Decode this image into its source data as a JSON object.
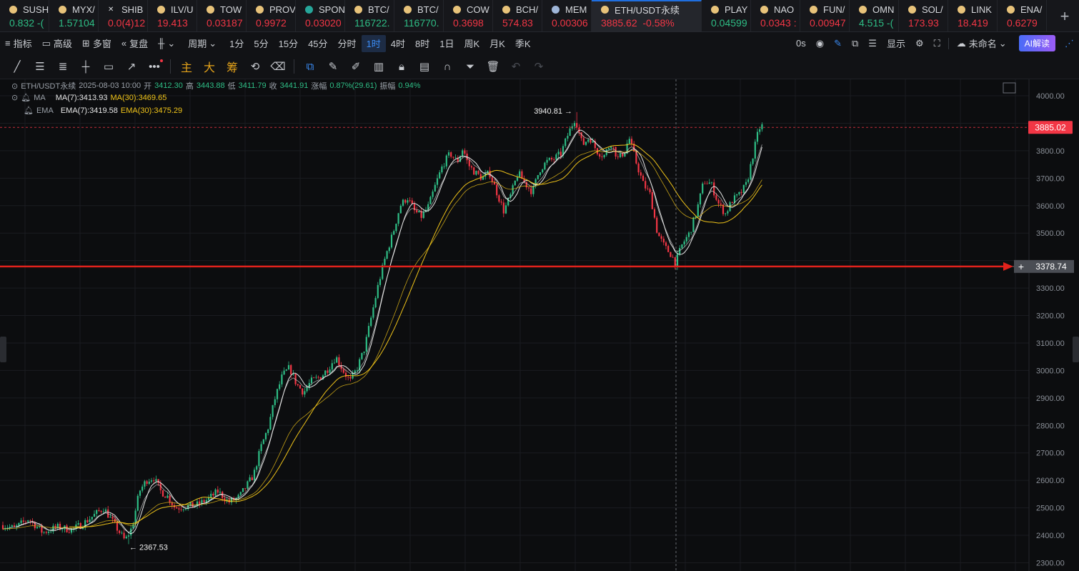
{
  "ticker_tabs": [
    {
      "symbol": "SUSH",
      "value": "0.832 -(",
      "dir": "up",
      "icon": "coin-icon",
      "icon_color": "#e8c37a"
    },
    {
      "symbol": "MYX/",
      "value": "1.57104",
      "dir": "up",
      "icon": "coin-icon",
      "icon_color": "#e8c37a"
    },
    {
      "symbol": "SHIB",
      "value": "0.0(4)12",
      "dir": "dn",
      "icon": "close-icon",
      "icon_color": "#d6d8dc"
    },
    {
      "symbol": "ILV/U",
      "value": "19.413",
      "dir": "dn",
      "icon": "coin-icon",
      "icon_color": "#e8c37a"
    },
    {
      "symbol": "TOW",
      "value": "0.03187",
      "dir": "dn",
      "icon": "coin-icon",
      "icon_color": "#e8c37a"
    },
    {
      "symbol": "PROV",
      "value": "0.9972",
      "dir": "dn",
      "icon": "coin-icon",
      "icon_color": "#e8c37a"
    },
    {
      "symbol": "SPON",
      "value": "0.03020",
      "dir": "dn",
      "icon": "coin-icon",
      "icon_color": "#26a69a"
    },
    {
      "symbol": "BTC/",
      "value": "116722.",
      "dir": "up",
      "icon": "coin-icon",
      "icon_color": "#e8c37a"
    },
    {
      "symbol": "BTC/",
      "value": "116770.",
      "dir": "up",
      "icon": "coin-icon",
      "icon_color": "#e8c37a"
    },
    {
      "symbol": "COW",
      "value": "0.3698",
      "dir": "dn",
      "icon": "coin-icon",
      "icon_color": "#e8c37a"
    },
    {
      "symbol": "BCH/",
      "value": "574.83",
      "dir": "dn",
      "icon": "coin-icon",
      "icon_color": "#e8c37a"
    },
    {
      "symbol": "MEM",
      "value": "0.00306",
      "dir": "dn",
      "icon": "coin-icon",
      "icon_color": "#9fb6d8"
    }
  ],
  "active_tab": {
    "symbol": "ETH/USDT永续",
    "price": "3885.62",
    "change": "-0.58%",
    "icon": "coin-icon",
    "icon_color": "#e8c37a"
  },
  "ticker_tabs_right": [
    {
      "symbol": "PLAY",
      "value": "0.04599",
      "dir": "up",
      "icon": "coin-icon",
      "icon_color": "#e8c37a"
    },
    {
      "symbol": "NAO",
      "value": "0.0343 :",
      "dir": "dn",
      "icon": "coin-icon",
      "icon_color": "#e8c37a"
    },
    {
      "symbol": "FUN/",
      "value": "0.00947",
      "dir": "dn",
      "icon": "coin-icon",
      "icon_color": "#e8c37a"
    },
    {
      "symbol": "OMN",
      "value": "4.515 -(",
      "dir": "up",
      "icon": "coin-icon",
      "icon_color": "#e8c37a"
    },
    {
      "symbol": "SOL/",
      "value": "173.93",
      "dir": "dn",
      "icon": "coin-icon",
      "icon_color": "#e8c37a"
    },
    {
      "symbol": "LINK",
      "value": "18.419",
      "dir": "dn",
      "icon": "coin-icon",
      "icon_color": "#e8c37a"
    },
    {
      "symbol": "ENA/",
      "value": "0.6279",
      "dir": "dn",
      "icon": "coin-icon",
      "icon_color": "#e8c37a"
    }
  ],
  "toolbar": {
    "indicators": "指标",
    "advanced": "高级",
    "multi_window": "多窗",
    "replay": "复盘",
    "period": "周期",
    "intervals": [
      "1分",
      "5分",
      "15分",
      "45分",
      "分时",
      "1时",
      "4时",
      "8时",
      "1日",
      "周K",
      "月K",
      "季K"
    ],
    "selected_interval": "1时",
    "countdown": "0s",
    "display": "显示",
    "layout_name": "未命名",
    "ai_button": "AI解读"
  },
  "draw_tools_cn": [
    "主",
    "大",
    "筹"
  ],
  "legend": {
    "symbol": "ETH/USDT永续",
    "datetime": "2025-08-03 10:00",
    "open_label": "开",
    "open": "3412.30",
    "high_label": "高",
    "high": "3443.88",
    "low_label": "低",
    "low": "3411.79",
    "close_label": "收",
    "close": "3441.91",
    "change_label": "涨幅",
    "change": "0.87%(29.61)",
    "amp_label": "振幅",
    "amp": "0.94%",
    "ma_name": "MA",
    "ma7": "MA(7):3413.93",
    "ma30": "MA(30):3469.65",
    "ema_name": "EMA",
    "ema7": "EMA(7):3419.58",
    "ema30": "EMA(30):3475.29"
  },
  "colors": {
    "up": "#2ebd85",
    "down": "#f23645",
    "ma7": "#e6e6e6",
    "ma30": "#f0c419",
    "annotation": "#e1221c",
    "accent": "#3b8cf5"
  },
  "chart_data": {
    "type": "candlestick",
    "title": "ETH/USDT永续",
    "interval": "1时",
    "ylim": [
      2270,
      4060
    ],
    "y_ticks": [
      4000,
      3900,
      3800,
      3700,
      3600,
      3500,
      3400,
      3300,
      3200,
      3100,
      3000,
      2900,
      2800,
      2700,
      2600,
      2500,
      2400,
      2300
    ],
    "grid": true,
    "current_price": 3885.02,
    "crosshair_price": 3378.74,
    "max_label": "3940.81",
    "max_price": 3940.81,
    "min_label": "2367.53",
    "min_price": 2367.53,
    "horizontal_line_price": 3378.74,
    "horizontal_line_color": "#e1221c",
    "close_path": [
      [
        0,
        2440
      ],
      [
        20,
        2425
      ],
      [
        40,
        2460
      ],
      [
        60,
        2410
      ],
      [
        80,
        2430
      ],
      [
        100,
        2420
      ],
      [
        115,
        2440
      ],
      [
        130,
        2470
      ],
      [
        145,
        2500
      ],
      [
        160,
        2440
      ],
      [
        175,
        2380
      ],
      [
        185,
        2430
      ],
      [
        195,
        2560
      ],
      [
        205,
        2600
      ],
      [
        215,
        2610
      ],
      [
        225,
        2560
      ],
      [
        235,
        2540
      ],
      [
        245,
        2500
      ],
      [
        260,
        2505
      ],
      [
        275,
        2510
      ],
      [
        290,
        2530
      ],
      [
        305,
        2560
      ],
      [
        320,
        2520
      ],
      [
        335,
        2540
      ],
      [
        345,
        2580
      ],
      [
        355,
        2620
      ],
      [
        365,
        2720
      ],
      [
        375,
        2790
      ],
      [
        385,
        2900
      ],
      [
        395,
        2980
      ],
      [
        405,
        3010
      ],
      [
        415,
        2950
      ],
      [
        425,
        2920
      ],
      [
        435,
        2960
      ],
      [
        450,
        2980
      ],
      [
        460,
        3010
      ],
      [
        470,
        3050
      ],
      [
        480,
        3000
      ],
      [
        490,
        2960
      ],
      [
        500,
        3010
      ],
      [
        510,
        3080
      ],
      [
        520,
        3200
      ],
      [
        530,
        3320
      ],
      [
        540,
        3420
      ],
      [
        550,
        3500
      ],
      [
        560,
        3600
      ],
      [
        570,
        3630
      ],
      [
        580,
        3580
      ],
      [
        590,
        3560
      ],
      [
        600,
        3600
      ],
      [
        610,
        3680
      ],
      [
        620,
        3750
      ],
      [
        630,
        3790
      ],
      [
        640,
        3760
      ],
      [
        648,
        3810
      ],
      [
        655,
        3750
      ],
      [
        665,
        3720
      ],
      [
        675,
        3700
      ],
      [
        685,
        3720
      ],
      [
        695,
        3650
      ],
      [
        705,
        3580
      ],
      [
        715,
        3640
      ],
      [
        725,
        3720
      ],
      [
        735,
        3680
      ],
      [
        745,
        3650
      ],
      [
        755,
        3730
      ],
      [
        765,
        3760
      ],
      [
        775,
        3770
      ],
      [
        785,
        3790
      ],
      [
        795,
        3860
      ],
      [
        805,
        3920
      ],
      [
        815,
        3820
      ],
      [
        825,
        3850
      ],
      [
        835,
        3800
      ],
      [
        845,
        3780
      ],
      [
        855,
        3830
      ],
      [
        865,
        3770
      ],
      [
        875,
        3800
      ],
      [
        880,
        3850
      ],
      [
        890,
        3760
      ],
      [
        900,
        3680
      ],
      [
        910,
        3640
      ],
      [
        920,
        3500
      ],
      [
        930,
        3450
      ],
      [
        940,
        3420
      ],
      [
        945,
        3390
      ],
      [
        955,
        3460
      ],
      [
        965,
        3500
      ],
      [
        975,
        3580
      ],
      [
        985,
        3690
      ],
      [
        995,
        3680
      ],
      [
        1005,
        3610
      ],
      [
        1015,
        3570
      ],
      [
        1025,
        3620
      ],
      [
        1035,
        3640
      ],
      [
        1045,
        3680
      ],
      [
        1055,
        3800
      ],
      [
        1062,
        3880
      ],
      [
        1066,
        3890
      ]
    ]
  }
}
